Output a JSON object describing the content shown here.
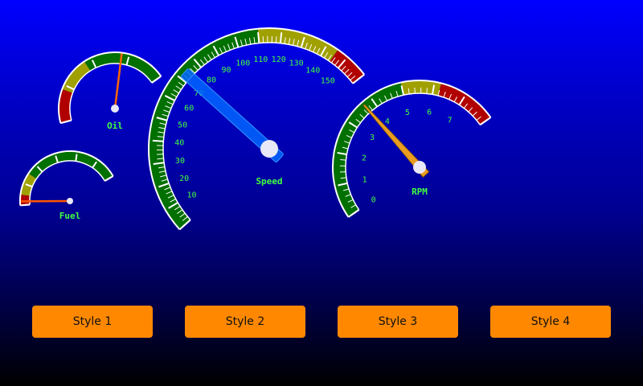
{
  "colors": {
    "background_top": "#0000ff",
    "background_bottom": "#000000",
    "band_green": "#007000",
    "band_olive": "#a0a000",
    "band_red": "#b00000",
    "label_green": "#40ff40",
    "button_orange": "#ff8800"
  },
  "gauges": {
    "oil": {
      "label": "Oil",
      "min": 0,
      "max": 1,
      "value": 0.7,
      "ticks": [],
      "major_count": 4,
      "minor_per_major": 0,
      "needle_color": "#ff6600",
      "bands": [
        {
          "from": 0,
          "to": 0.22,
          "color": "#b00000"
        },
        {
          "from": 0.22,
          "to": 0.45,
          "color": "#a0a000"
        },
        {
          "from": 0.45,
          "to": 1,
          "color": "#007000"
        }
      ]
    },
    "fuel": {
      "label": "Fuel",
      "min": 0,
      "max": 1,
      "value": 0.03,
      "ticks": [],
      "major_count": 6,
      "minor_per_major": 0,
      "needle_color": "#ff5500",
      "bands": [
        {
          "from": 0,
          "to": 0.08,
          "color": "#b00000"
        },
        {
          "from": 0.08,
          "to": 0.25,
          "color": "#a0a000"
        },
        {
          "from": 0.25,
          "to": 1,
          "color": "#007000"
        }
      ]
    },
    "speed": {
      "label": "Speed",
      "min": 0,
      "max": 160,
      "value": 73,
      "ticks": [
        "10",
        "20",
        "30",
        "40",
        "50",
        "60",
        "70",
        "80",
        "90",
        "100",
        "110",
        "120",
        "130",
        "140",
        "150"
      ],
      "tick_values": [
        10,
        20,
        30,
        40,
        50,
        60,
        70,
        80,
        90,
        100,
        110,
        120,
        130,
        140,
        150
      ],
      "major_count": 16,
      "minor_per_major": 5,
      "needle_color": "#0066ff",
      "bands": [
        {
          "from": 0,
          "to": 110,
          "color": "#007000"
        },
        {
          "from": 110,
          "to": 145,
          "color": "#a0a000"
        },
        {
          "from": 145,
          "to": 160,
          "color": "#b00000"
        }
      ]
    },
    "rpm": {
      "label": "RPM",
      "min": 0,
      "max": 8,
      "value": 3.7,
      "ticks": [
        "0",
        "1",
        "2",
        "3",
        "4",
        "5",
        "6",
        "7"
      ],
      "tick_values": [
        0,
        1,
        2,
        3,
        4,
        5,
        6,
        7
      ],
      "major_count": 8,
      "minor_per_major": 5,
      "needle_color": "#e89c20",
      "bands": [
        {
          "from": 0,
          "to": 5,
          "color": "#007000"
        },
        {
          "from": 5,
          "to": 6.2,
          "color": "#a0a000"
        },
        {
          "from": 6.2,
          "to": 8,
          "color": "#b00000"
        }
      ]
    }
  },
  "buttons": {
    "style1": "Style 1",
    "style2": "Style 2",
    "style3": "Style 3",
    "style4": "Style 4"
  }
}
